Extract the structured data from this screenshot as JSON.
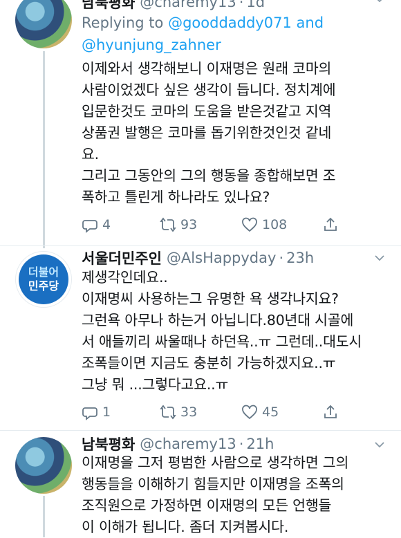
{
  "tweets": [
    {
      "name": "남북평화",
      "handle": "@charemy13",
      "dot": "·",
      "time": "1d",
      "reply_prefix": "Replying to",
      "reply_user1": "@gooddaddy071",
      "reply_and": "and",
      "reply_user2": "@hyunjung_zahner",
      "text": "이제와서 생각해보니 이재명은 원래 코마의\n사람이었겠다 싶은 생각이 듭니다. 정치계에\n입문한것도 코마의 도움을 받은것같고 지역\n상품권 발행은 코마를 돕기위한것인것 같네\n요.\n그리고 그동안의 그의 행동을 종합해보면 조\n폭하고 틀린게 하나라도 있나요?",
      "replies": "4",
      "retweets": "93",
      "likes": "108"
    },
    {
      "name": "서울더민주인",
      "handle": "@AlsHappyday",
      "dot": "·",
      "time": "23h",
      "avatar_line1": "더불어",
      "avatar_line2": "민주당",
      "text": "제생각인데요..\n이재명씨 사용하는그 유명한 욕 생각나지요?\n그런욕 아무나 하는거 아닙니다.80년대 시골에\n서 애들끼리 싸울때나 하던욕..ㅠ 그런데..대도시\n조폭들이면 지금도 충분히 가능하겠지요..ㅠ\n그냥 뭐 ...그렇다고요..ㅠ",
      "replies": "1",
      "retweets": "33",
      "likes": "45"
    },
    {
      "name": "남북평화",
      "handle": "@charemy13",
      "dot": "·",
      "time": "21h",
      "text": "이재명을 그저 평범한 사람으로 생각하면 그의\n행동들을 이해하기 힘들지만 이재명을 조폭의\n조직원으로 가정하면 이재명의 모든 언행들\n이 이해가 됩니다. 좀더 지켜봅시다."
    }
  ]
}
